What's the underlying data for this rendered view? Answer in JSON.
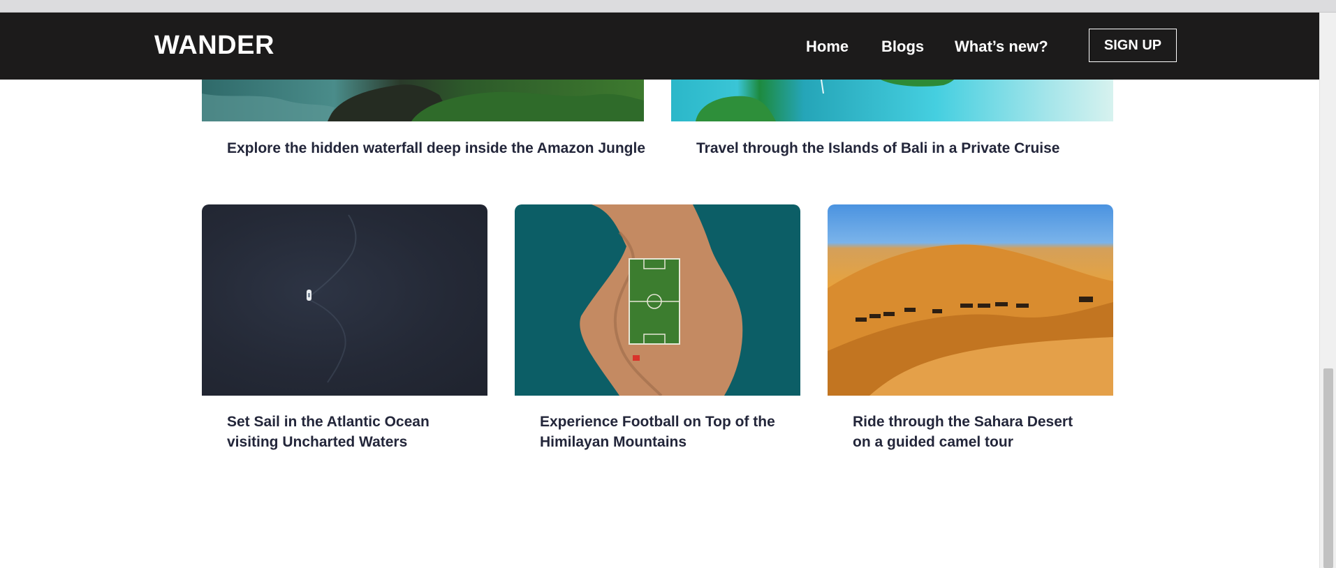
{
  "header": {
    "brand": "WANDER",
    "nav": {
      "home": "Home",
      "blogs": "Blogs",
      "whats_new": "What’s new?"
    },
    "signup_label": "SIGN UP"
  },
  "cards": [
    {
      "title": "Explore the hidden waterfall deep inside the Amazon Jungle",
      "image": "amazon-waterfall-image"
    },
    {
      "title": "Travel through the Islands of Bali in a Private Cruise",
      "image": "bali-islands-image"
    },
    {
      "title": "Set Sail in the Atlantic Ocean visiting Uncharted Waters",
      "image": "atlantic-ocean-boat-image"
    },
    {
      "title": "Experience Football on Top of the Himilayan Mountains",
      "image": "island-football-field-image"
    },
    {
      "title": "Ride through the Sahara Desert on a guided camel tour",
      "image": "sahara-camels-image"
    }
  ],
  "colors": {
    "navbar_bg": "#1c1b1b",
    "title_text": "#23263a"
  }
}
